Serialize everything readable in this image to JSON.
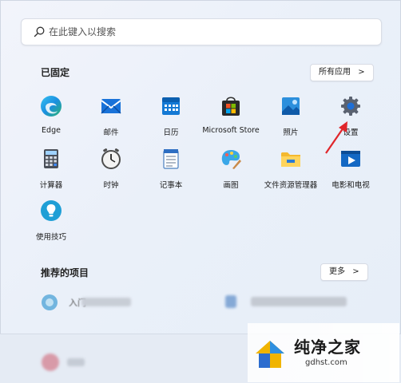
{
  "search": {
    "placeholder": "在此键入以搜索"
  },
  "pinned": {
    "title": "已固定",
    "all_apps_label": "所有应用",
    "all_apps_chevron": ">",
    "apps": [
      {
        "label": "Edge",
        "icon": "edge-icon"
      },
      {
        "label": "邮件",
        "icon": "mail-icon"
      },
      {
        "label": "日历",
        "icon": "calendar-icon"
      },
      {
        "label": "Microsoft Store",
        "icon": "store-icon"
      },
      {
        "label": "照片",
        "icon": "photos-icon"
      },
      {
        "label": "设置",
        "icon": "settings-gear-icon"
      },
      {
        "label": "计算器",
        "icon": "calculator-icon"
      },
      {
        "label": "时钟",
        "icon": "clock-icon"
      },
      {
        "label": "记事本",
        "icon": "notepad-icon"
      },
      {
        "label": "画图",
        "icon": "paint-icon"
      },
      {
        "label": "文件资源管理器",
        "icon": "folder-icon"
      },
      {
        "label": "电影和电视",
        "icon": "movies-tv-icon"
      },
      {
        "label": "使用技巧",
        "icon": "tips-icon"
      }
    ]
  },
  "recommended": {
    "title": "推荐的项目",
    "more_label": "更多",
    "more_chevron": ">",
    "item1_text": "入门"
  },
  "watermark": {
    "brand": "纯净之家",
    "url": "gdhst.com"
  },
  "colors": {
    "accent": "#0a6fd1",
    "arrow": "#e0262b"
  }
}
